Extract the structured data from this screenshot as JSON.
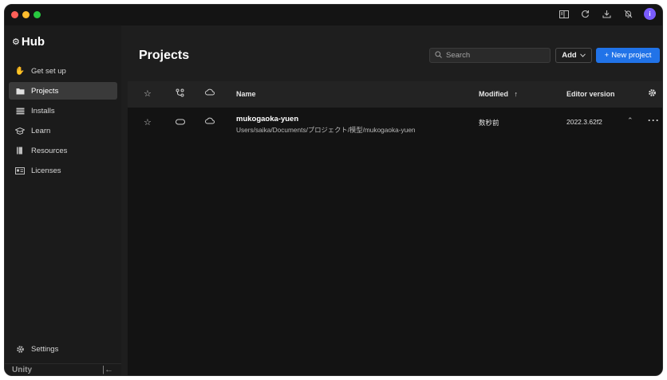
{
  "titlebar": {
    "icons": [
      "layout-icon",
      "refresh-icon",
      "download-icon",
      "bell-off-icon",
      "avatar"
    ],
    "avatar_initial": "i"
  },
  "sidebar": {
    "logo_text": "Hub",
    "items": [
      {
        "label": "Get set up",
        "icon": "waving-hand-icon"
      },
      {
        "label": "Projects",
        "icon": "folder-icon",
        "active": true
      },
      {
        "label": "Installs",
        "icon": "list-icon"
      },
      {
        "label": "Learn",
        "icon": "graduation-cap-icon"
      },
      {
        "label": "Resources",
        "icon": "book-icon"
      },
      {
        "label": "Licenses",
        "icon": "license-icon"
      }
    ],
    "settings_label": "Settings",
    "footer_label": "Unity"
  },
  "main": {
    "title": "Projects",
    "search_placeholder": "Search",
    "add_label": "Add",
    "new_project_label": "New project"
  },
  "table": {
    "headers": {
      "name": "Name",
      "modified": "Modified",
      "editor_version": "Editor version"
    },
    "rows": [
      {
        "name": "mukogaoka-yuen",
        "path": "Users/saika/Documents/プロジェクト/模型/mukogaoka-yuen",
        "modified": "数秒前",
        "editor_version": "2022.3.62f2"
      }
    ]
  },
  "colors": {
    "accent": "#2173e8",
    "background": "#1e1e1e",
    "sidebar": "#1b1b1b"
  }
}
